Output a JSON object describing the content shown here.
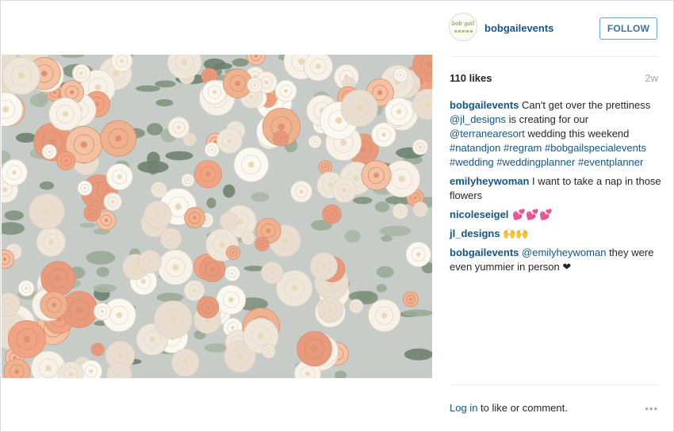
{
  "post": {
    "username": "bobgailevents",
    "avatar_text": "bob gail",
    "follow_label": "FOLLOW",
    "likes": "110 likes",
    "age": "2w"
  },
  "comments": [
    {
      "user": "bobgailevents",
      "parts": [
        {
          "text": " Can't get over the prettiness ",
          "link": false
        },
        {
          "text": "@jl_designs",
          "link": true
        },
        {
          "text": " is creating for our ",
          "link": false
        },
        {
          "text": "@terranearesort",
          "link": true
        },
        {
          "text": " wedding this weekend ",
          "link": false
        },
        {
          "text": "#natandjon",
          "link": true
        },
        {
          "text": " ",
          "link": false
        },
        {
          "text": "#regram",
          "link": true
        },
        {
          "text": " ",
          "link": false
        },
        {
          "text": "#bobgailspecialevents",
          "link": true
        },
        {
          "text": " ",
          "link": false
        },
        {
          "text": "#wedding",
          "link": true
        },
        {
          "text": " ",
          "link": false
        },
        {
          "text": "#weddingplanner",
          "link": true
        },
        {
          "text": " ",
          "link": false
        },
        {
          "text": "#eventplanner",
          "link": true
        }
      ]
    },
    {
      "user": "emilyheywoman",
      "parts": [
        {
          "text": " I want to take a nap in those flowers",
          "link": false
        }
      ]
    },
    {
      "user": "nicoleseigel",
      "parts": [
        {
          "text": " 💕💕💕",
          "link": false,
          "style": "hearts"
        }
      ]
    },
    {
      "user": "jl_designs",
      "parts": [
        {
          "text": " 🙌🙌",
          "link": false,
          "style": "hands"
        }
      ]
    },
    {
      "user": "bobgailevents",
      "parts": [
        {
          "text": " ",
          "link": false
        },
        {
          "text": "@emilyheywoman",
          "link": true
        },
        {
          "text": " they were even yummier in person ❤",
          "link": false
        }
      ]
    }
  ],
  "footer": {
    "login_label": "Log in",
    "rest_text": " to like or comment.",
    "more_icon": "•••"
  },
  "colors": {
    "link": "#125688",
    "follow_border": "#70a1c9",
    "muted": "#a5a7aa",
    "peach_rose": "#f0a483",
    "cream_rose": "#f6efe6",
    "sage_leaf": "#8e9e8a"
  }
}
